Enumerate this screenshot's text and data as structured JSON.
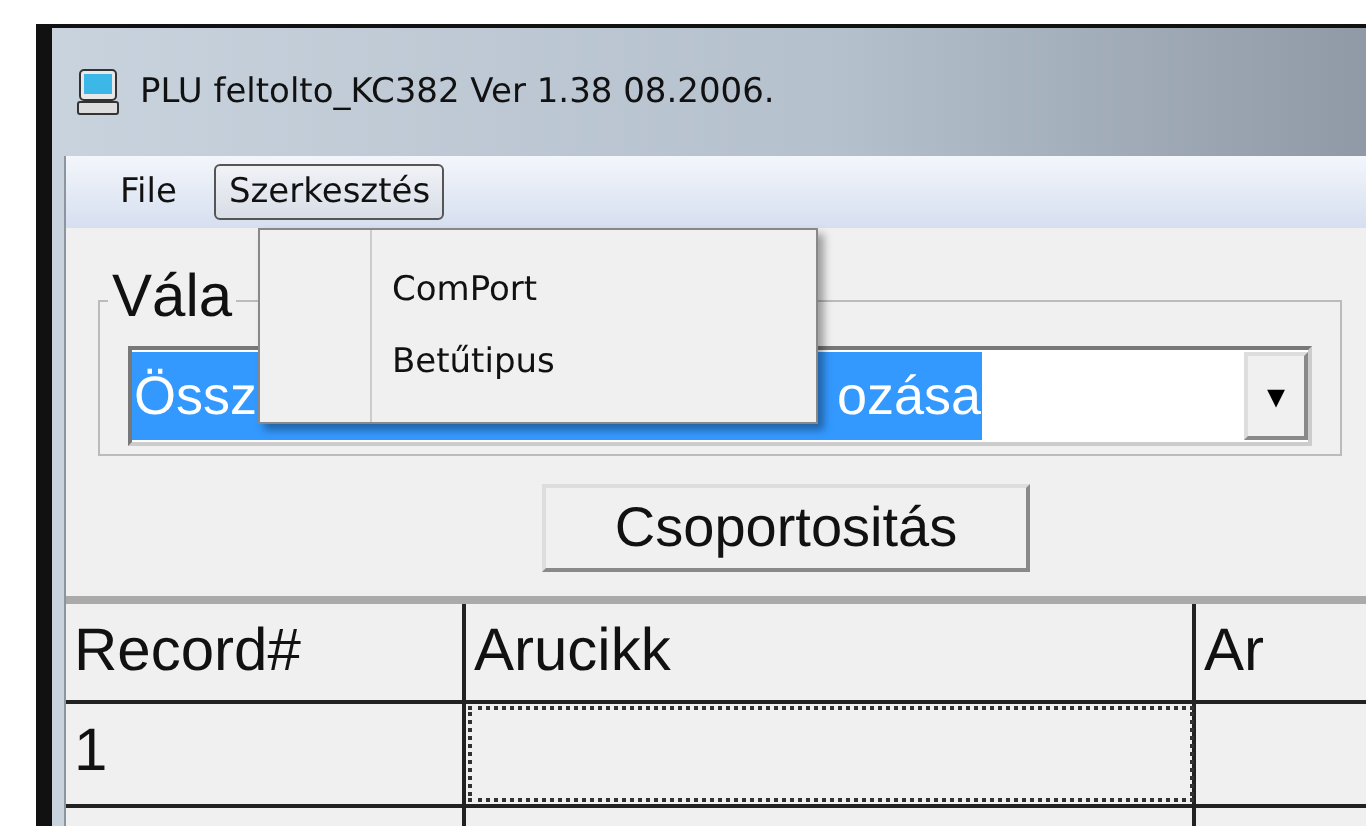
{
  "window": {
    "title": "PLU feltolto_KC382 Ver 1.38  08.2006."
  },
  "menu_bar": [
    {
      "label": "File",
      "selected": false
    },
    {
      "label": "Szerkesztés",
      "selected": true
    }
  ],
  "open_menu": {
    "items": [
      "ComPort",
      "Betűtipus"
    ]
  },
  "group": {
    "label": "Vála",
    "combo": {
      "value_start": "Össz",
      "value_end": "ozása",
      "dropdown": "▾"
    }
  },
  "button": "Csoportositás",
  "table": {
    "columns": [
      "Record#",
      "Arucikk",
      "Ar"
    ],
    "rows": [
      [
        "1",
        "",
        ""
      ]
    ]
  }
}
